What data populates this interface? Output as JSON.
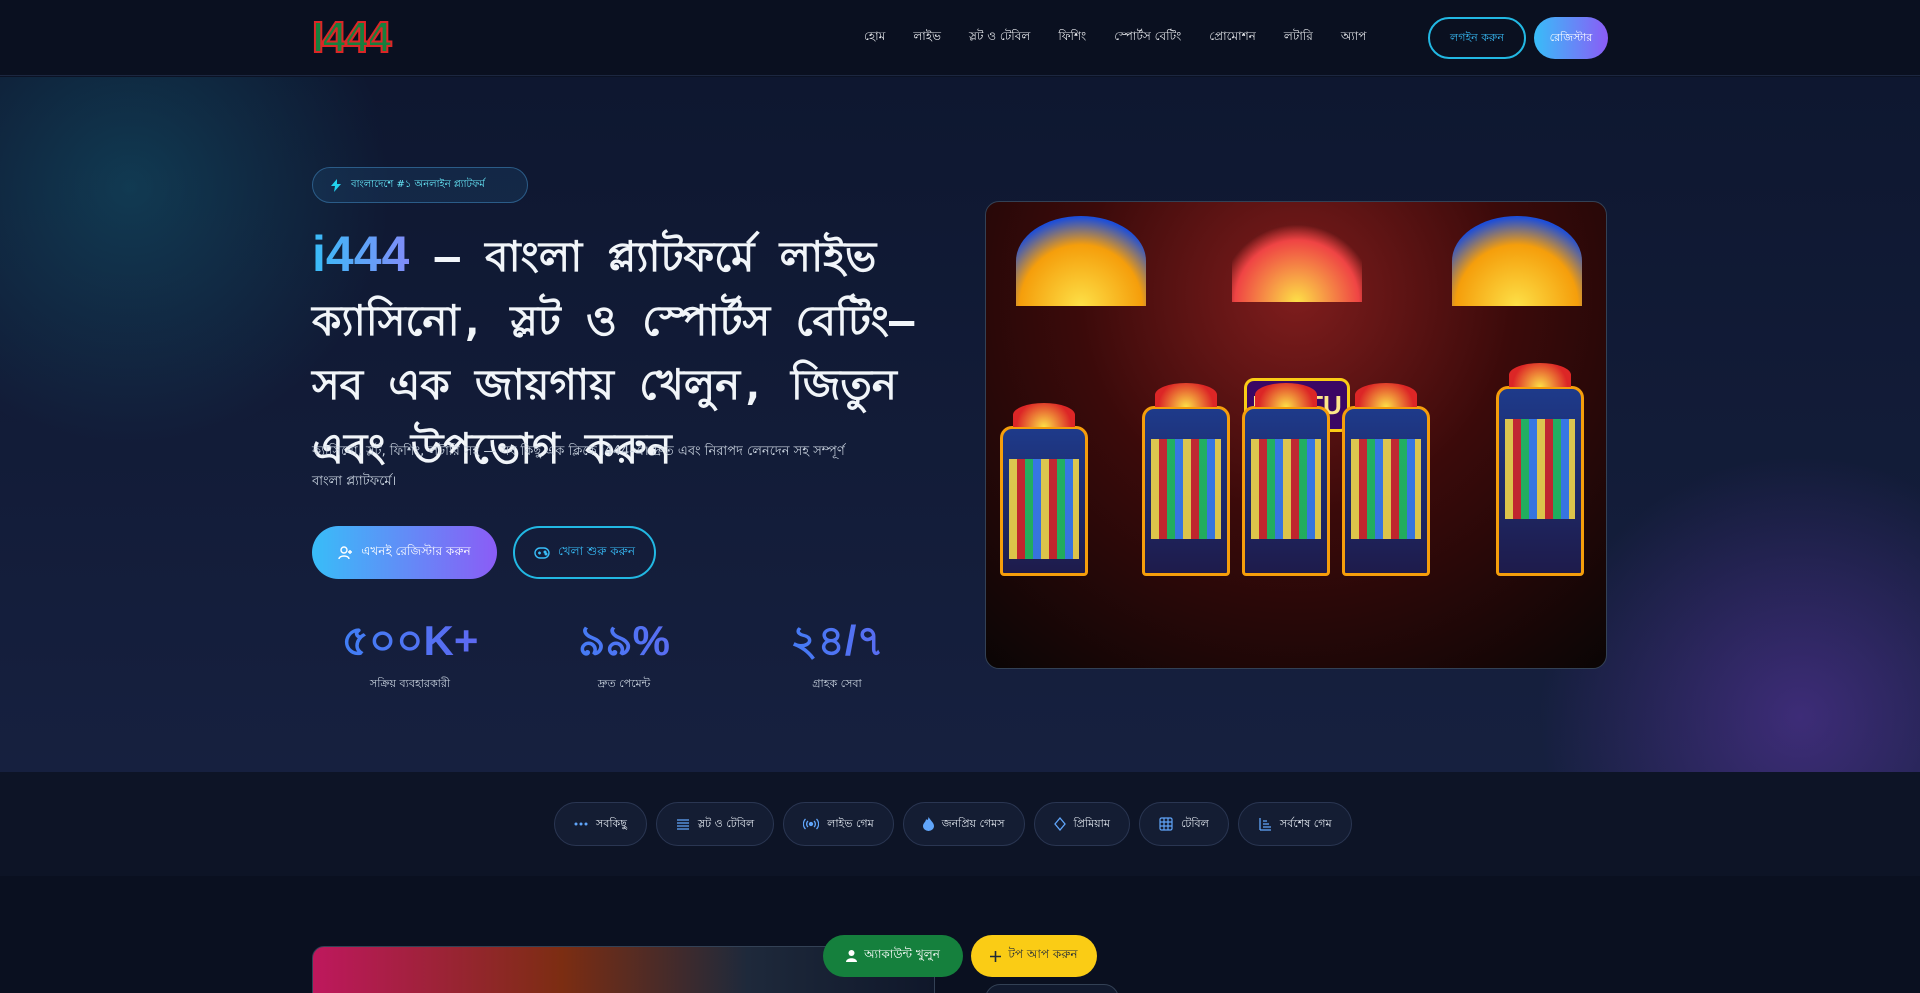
{
  "header": {
    "logo": "I444",
    "nav": [
      "হোম",
      "লাইভ",
      "স্লট ও টেবিল",
      "ফিশিং",
      "স্পোর্টস বেটিং",
      "প্রোমোশন",
      "লটারি",
      "অ্যাপ"
    ],
    "login_label": "লগইন করুন",
    "register_label": "রেজিস্টার"
  },
  "hero": {
    "badge": "বাংলাদেশে #১ অনলাইন প্ল্যাটফর্ম",
    "headline_brand": "i444",
    "headline_rest": " — বাংলা প্ল্যাটফর্মে লাইভ ক্যাসিনো, স্লট ও স্পোর্টস বেটিং—সব এক জায়গায় খেলুন, জিতুন এবং উপভোগ করুন",
    "lead": "ক্যাসিনো, স্লট, ফিশিং, লটারি সহ — সব কিছু এক ক্লিকে i444-এ। দ্রুত এবং নিরাপদ লেনদেন সহ সম্পূর্ণ বাংলা প্ল্যাটফর্মে।",
    "cta_primary": "এখনই রেজিস্টার করুন",
    "cta_secondary": "খেলা শুরু করুন",
    "stats": [
      {
        "value": "৫০০K+",
        "label": "সক্রিয় ব্যবহারকারী"
      },
      {
        "value": "৯৯%",
        "label": "দ্রুত পেমেন্ট"
      },
      {
        "value": "২৪/৭",
        "label": "গ্রাহক সেবা"
      }
    ],
    "image_sign": "LAOTU"
  },
  "categories": [
    {
      "icon": "dots-icon",
      "label": "সবকিছু"
    },
    {
      "icon": "layers-icon",
      "label": "স্লট ও টেবিল"
    },
    {
      "icon": "broadcast-icon",
      "label": "লাইভ গেম"
    },
    {
      "icon": "flame-icon",
      "label": "জনপ্রিয় গেমস"
    },
    {
      "icon": "diamond-icon",
      "label": "প্রিমিয়াম"
    },
    {
      "icon": "grid-icon",
      "label": "টেবিল"
    },
    {
      "icon": "sort-icon",
      "label": "সর্বশেষ গেম"
    }
  ],
  "floating": {
    "account_label": "অ্যাকাউন্ট খুলুন",
    "deposit_label": "টপ আপ করুন"
  },
  "colors": {
    "accent_cyan": "#38bdf8",
    "accent_violet": "#8b5cf6",
    "green": "#15803d",
    "yellow": "#facc15"
  }
}
